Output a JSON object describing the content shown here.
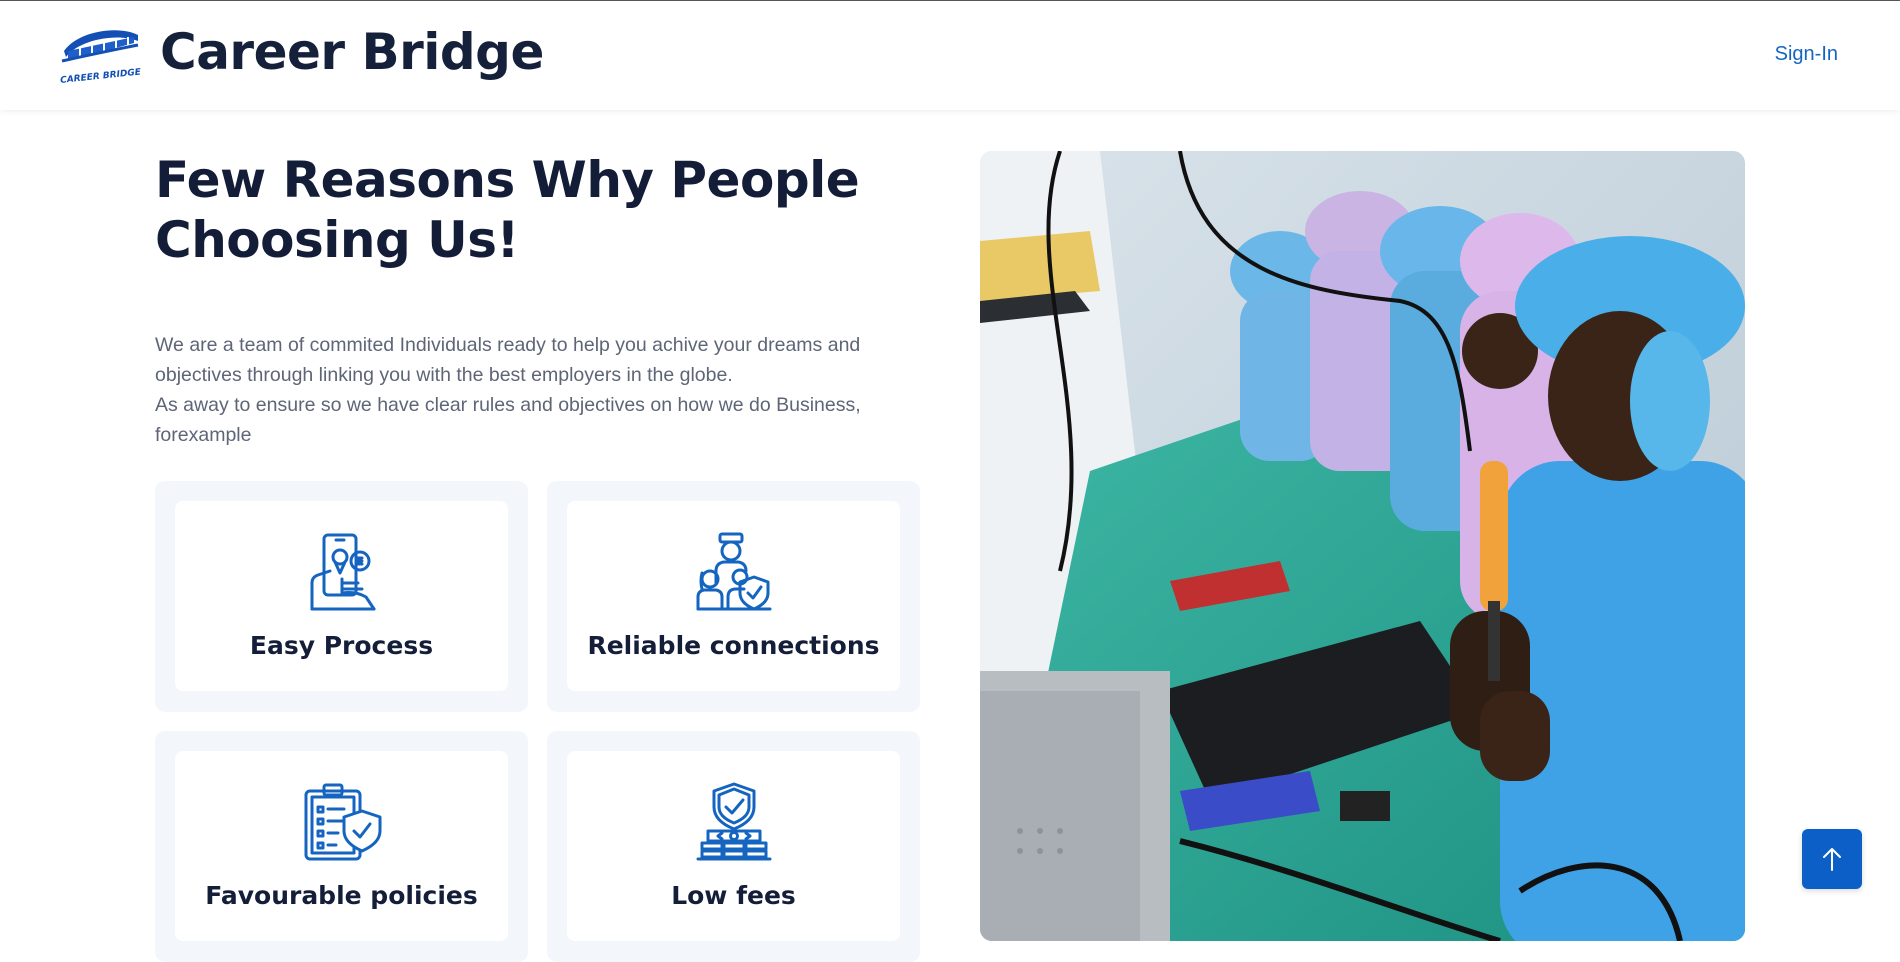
{
  "header": {
    "brand_name": "Career Bridge",
    "logo_text": "CAREER BRIDGE",
    "signin_label": "Sign-In"
  },
  "section": {
    "heading": "Few Reasons Why People Choosing Us!",
    "description_line1": "We are a team of commited Individuals ready to help you achive your dreams and objectives through linking you with the best employers in the globe.",
    "description_line2": "As away to ensure so we have clear rules and objectives on how we do Business, forexample"
  },
  "features": [
    {
      "title": "Easy Process",
      "icon": "mobile-hand-icon"
    },
    {
      "title": "Reliable connections",
      "icon": "family-shield-icon"
    },
    {
      "title": "Favourable policies",
      "icon": "clipboard-shield-icon"
    },
    {
      "title": "Low fees",
      "icon": "shield-money-icon"
    }
  ],
  "colors": {
    "brand_blue": "#1565c0",
    "heading": "#131d38",
    "card_bg": "#f3f6fb",
    "back_to_top": "#0d5fc8"
  }
}
